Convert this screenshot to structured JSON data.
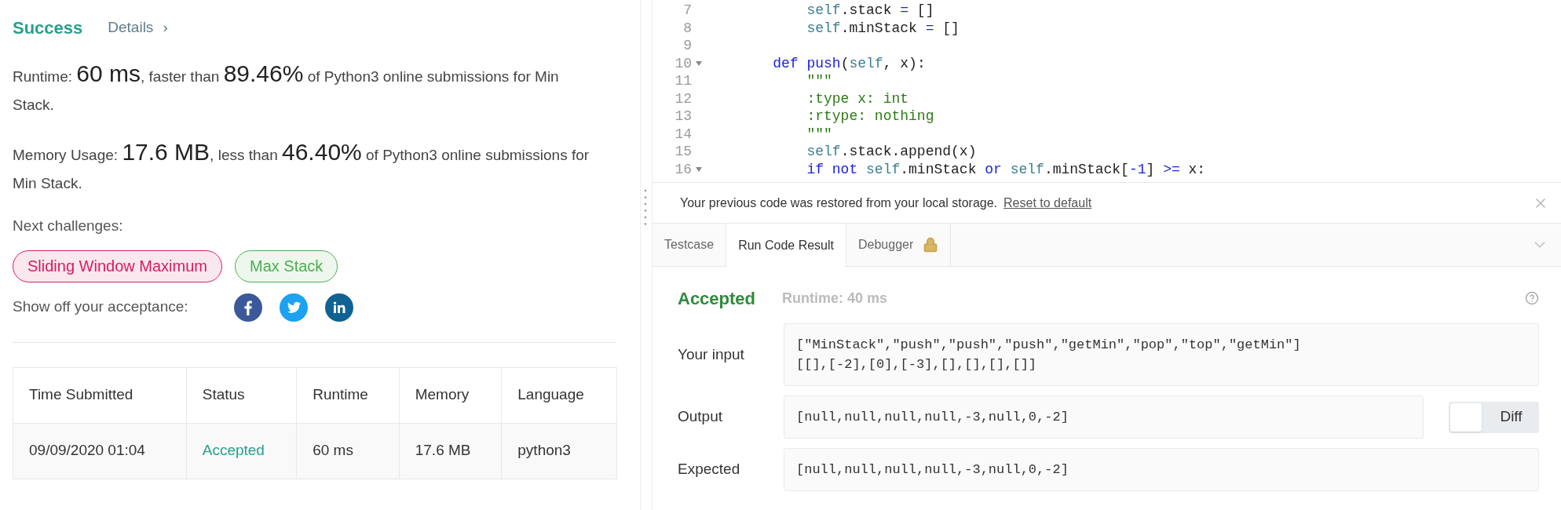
{
  "result": {
    "status": "Success",
    "details_link": "Details",
    "details_arrow": "›"
  },
  "runtime": {
    "parts": [
      {
        "text": "Runtime: ",
        "big": false
      },
      {
        "text": "60 ms",
        "big": true
      },
      {
        "text": ", faster than ",
        "big": false
      },
      {
        "text": "89.46%",
        "big": true
      },
      {
        "text": " of Python3 online submissions for Min Stack.",
        "big": false
      }
    ]
  },
  "memory": {
    "parts": [
      {
        "text": "Memory Usage: ",
        "big": false
      },
      {
        "text": "17.6 MB",
        "big": true
      },
      {
        "text": ", less than ",
        "big": false
      },
      {
        "text": "46.40%",
        "big": true
      },
      {
        "text": " of Python3 online submissions for Min Stack.",
        "big": false
      }
    ]
  },
  "next_challenges": {
    "label": "Next challenges:",
    "items": [
      {
        "label": "Sliding Window Maximum",
        "color": "#d81b60"
      },
      {
        "label": "Max Stack",
        "color": "#4caf50"
      }
    ]
  },
  "share": {
    "label": "Show off your acceptance:",
    "networks": [
      {
        "kind": "facebook"
      },
      {
        "kind": "twitter"
      },
      {
        "kind": "linkedin"
      }
    ]
  },
  "table": {
    "columns": [
      "Time Submitted",
      "Status",
      "Runtime",
      "Memory",
      "Language"
    ],
    "rows": [
      {
        "cells": [
          "09/09/2020 01:04",
          "Accepted",
          "60 ms",
          "17.6 MB",
          "python3"
        ]
      }
    ]
  },
  "editor": {
    "lines": [
      {
        "number": "7",
        "fold": false,
        "tokens": [
          {
            "kind": "self",
            "text": "        self"
          },
          {
            "kind": "plain",
            "text": ".stack "
          },
          {
            "kind": "op",
            "text": "="
          },
          {
            "kind": "plain",
            "text": " []"
          }
        ]
      },
      {
        "number": "8",
        "fold": false,
        "tokens": [
          {
            "kind": "self",
            "text": "        self"
          },
          {
            "kind": "plain",
            "text": ".minStack "
          },
          {
            "kind": "op",
            "text": "="
          },
          {
            "kind": "plain",
            "text": " []"
          }
        ]
      },
      {
        "number": "9",
        "fold": false
      },
      {
        "number": "10",
        "fold": true,
        "tokens": [
          {
            "kind": "keyword",
            "text": "    def"
          },
          {
            "kind": "def",
            "text": " push"
          },
          {
            "kind": "plain",
            "text": "("
          },
          {
            "kind": "self",
            "text": "self"
          },
          {
            "kind": "plain",
            "text": ", x):"
          }
        ]
      },
      {
        "number": "11",
        "fold": false,
        "tokens": [
          {
            "kind": "string",
            "text": "        \"\"\""
          }
        ]
      },
      {
        "number": "12",
        "fold": false,
        "tokens": [
          {
            "kind": "string",
            "text": "        :type x: int"
          }
        ]
      },
      {
        "number": "13",
        "fold": false,
        "tokens": [
          {
            "kind": "string",
            "text": "        :rtype: nothing"
          }
        ]
      },
      {
        "number": "14",
        "fold": false,
        "tokens": [
          {
            "kind": "string",
            "text": "        \"\"\""
          }
        ]
      },
      {
        "number": "15",
        "fold": false,
        "tokens": [
          {
            "kind": "self",
            "text": "        self"
          },
          {
            "kind": "plain",
            "text": ".stack.append(x)"
          }
        ]
      },
      {
        "number": "16",
        "fold": true,
        "tokens": [
          {
            "kind": "keyword",
            "text": "        if not"
          },
          {
            "kind": "self",
            "text": " self"
          },
          {
            "kind": "plain",
            "text": ".minStack "
          },
          {
            "kind": "keyword",
            "text": "or"
          },
          {
            "kind": "self",
            "text": " self"
          },
          {
            "kind": "plain",
            "text": ".minStack["
          },
          {
            "kind": "number",
            "text": "-1"
          },
          {
            "kind": "plain",
            "text": "] "
          },
          {
            "kind": "op",
            "text": ">="
          },
          {
            "kind": "plain",
            "text": " x:"
          }
        ]
      }
    ]
  },
  "notice": {
    "text": "Your previous code was restored from your local storage.",
    "link": "Reset to default"
  },
  "tabs": [
    {
      "label": "Testcase",
      "selected": false,
      "locked": false
    },
    {
      "label": "Run Code Result",
      "selected": true,
      "locked": false
    },
    {
      "label": "Debugger",
      "selected": false,
      "locked": true
    }
  ],
  "run_result": {
    "status": "Accepted",
    "runtime": "Runtime: 40 ms",
    "fields": [
      {
        "label": "Your input",
        "lines": [
          "[\"MinStack\",\"push\",\"push\",\"push\",\"getMin\",\"pop\",\"top\",\"getMin\"]",
          "[[],[-2],[0],[-3],[],[],[],[]]"
        ]
      },
      {
        "label": "Output",
        "lines": [
          "[null,null,null,null,-3,null,0,-2]"
        ],
        "diff": {
          "label": "Diff",
          "on": false
        }
      },
      {
        "label": "Expected",
        "lines": [
          "[null,null,null,null,-3,null,0,-2]"
        ]
      }
    ]
  }
}
